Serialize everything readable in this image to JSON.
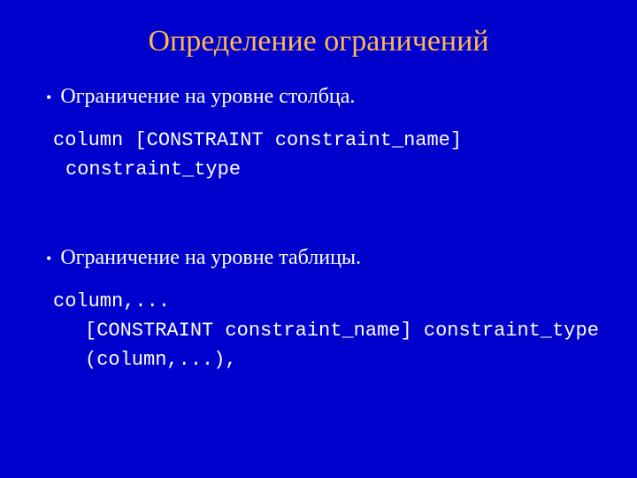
{
  "title": "Определение ограничений",
  "bullets": {
    "item1": "Ограничение на уровне столбца.",
    "item2": "Ограничение на уровне таблицы."
  },
  "code1": {
    "line1": "column [CONSTRAINT constraint_name]",
    "line2": "constraint_type"
  },
  "code2": {
    "line1": "column,...",
    "line2": "[CONSTRAINT constraint_name] constraint_type",
    "line3": "(column,...),"
  }
}
